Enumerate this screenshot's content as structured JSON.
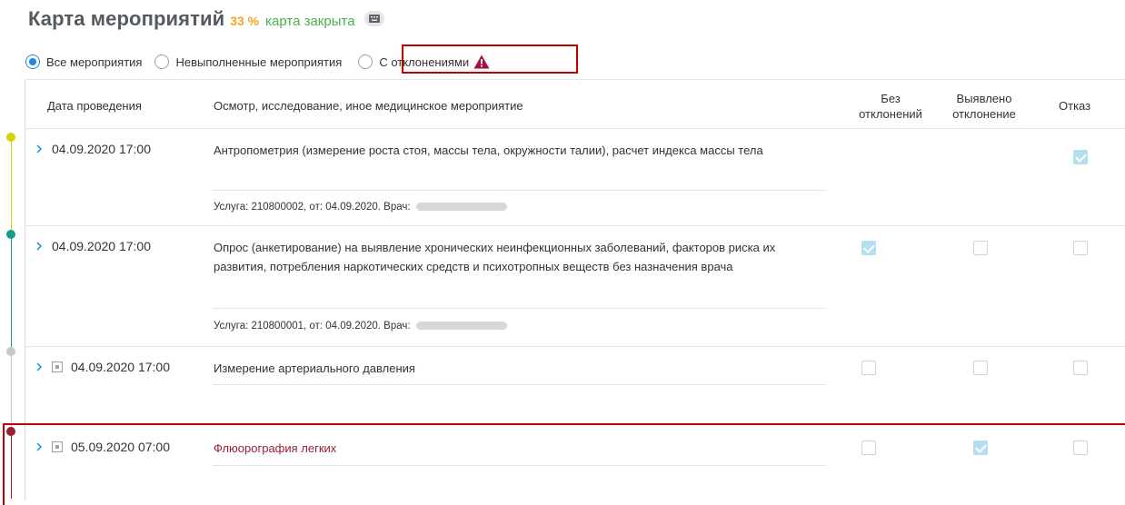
{
  "header": {
    "title": "Карта мероприятий",
    "percent": "33 %",
    "status": "карта закрыта"
  },
  "filters": {
    "all": "Все мероприятия",
    "unfulfilled": "Невыполненные мероприятия",
    "deviations": "С отклонениями",
    "selected": "all"
  },
  "columns": {
    "date": "Дата проведения",
    "event": "Осмотр, исследование, иное медицинское мероприятие",
    "no_deviation_1": "Без",
    "no_deviation_2": "отклонений",
    "deviation_1": "Выявлено",
    "deviation_2": "отклонение",
    "refusal": "Отказ"
  },
  "rows": [
    {
      "date": "04.09.2020 17:00",
      "description": "Антропометрия (измерение роста стоя, массы тела, окружности талии), расчет индекса массы тела",
      "service": "Услуга: 210800002, от: 04.09.2020. Врач:",
      "no_deviation": false,
      "deviation": false,
      "refusal": true
    },
    {
      "date": "04.09.2020 17:00",
      "description": "Опрос (анкетирование) на выявление хронических неинфекционных заболеваний, факторов риска их развития, потребления наркотических средств и психотропных веществ без назначения врача",
      "service": "Услуга: 210800001, от: 04.09.2020. Врач:",
      "no_deviation": true,
      "deviation": false,
      "refusal": false
    },
    {
      "date": "04.09.2020 17:00",
      "description": "Измерение артериального давления",
      "no_deviation": false,
      "deviation": false,
      "refusal": false
    },
    {
      "date": "05.09.2020 07:00",
      "description": "Флюорография легких",
      "no_deviation": false,
      "deviation": true,
      "refusal": false
    }
  ],
  "colors": {
    "accent": "#1e88e5",
    "percent": "#f5a623",
    "status": "#4caf50",
    "deviation_text": "#9c1c35",
    "highlight": "#c00000",
    "timeline": [
      "#d4d400",
      "#139e8f",
      "#c7c7c7",
      "#9c1c35"
    ]
  },
  "icons": [
    "keyboard-icon",
    "warning-icon",
    "chevron-right-icon",
    "calendar-icon",
    "checkbox"
  ]
}
